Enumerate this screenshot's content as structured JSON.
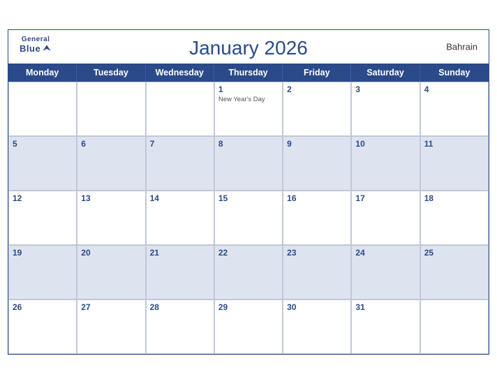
{
  "header": {
    "logo": {
      "general": "General",
      "blue": "Blue",
      "bird_unicode": "▲"
    },
    "title": "January 2026",
    "country": "Bahrain"
  },
  "days": [
    "Monday",
    "Tuesday",
    "Wednesday",
    "Thursday",
    "Friday",
    "Saturday",
    "Sunday"
  ],
  "weeks": [
    {
      "blue": false,
      "cells": [
        {
          "num": "",
          "holiday": ""
        },
        {
          "num": "",
          "holiday": ""
        },
        {
          "num": "",
          "holiday": ""
        },
        {
          "num": "1",
          "holiday": "New Year's Day"
        },
        {
          "num": "2",
          "holiday": ""
        },
        {
          "num": "3",
          "holiday": ""
        },
        {
          "num": "4",
          "holiday": ""
        }
      ]
    },
    {
      "blue": true,
      "cells": [
        {
          "num": "5",
          "holiday": ""
        },
        {
          "num": "6",
          "holiday": ""
        },
        {
          "num": "7",
          "holiday": ""
        },
        {
          "num": "8",
          "holiday": ""
        },
        {
          "num": "9",
          "holiday": ""
        },
        {
          "num": "10",
          "holiday": ""
        },
        {
          "num": "11",
          "holiday": ""
        }
      ]
    },
    {
      "blue": false,
      "cells": [
        {
          "num": "12",
          "holiday": ""
        },
        {
          "num": "13",
          "holiday": ""
        },
        {
          "num": "14",
          "holiday": ""
        },
        {
          "num": "15",
          "holiday": ""
        },
        {
          "num": "16",
          "holiday": ""
        },
        {
          "num": "17",
          "holiday": ""
        },
        {
          "num": "18",
          "holiday": ""
        }
      ]
    },
    {
      "blue": true,
      "cells": [
        {
          "num": "19",
          "holiday": ""
        },
        {
          "num": "20",
          "holiday": ""
        },
        {
          "num": "21",
          "holiday": ""
        },
        {
          "num": "22",
          "holiday": ""
        },
        {
          "num": "23",
          "holiday": ""
        },
        {
          "num": "24",
          "holiday": ""
        },
        {
          "num": "25",
          "holiday": ""
        }
      ]
    },
    {
      "blue": false,
      "cells": [
        {
          "num": "26",
          "holiday": ""
        },
        {
          "num": "27",
          "holiday": ""
        },
        {
          "num": "28",
          "holiday": ""
        },
        {
          "num": "29",
          "holiday": ""
        },
        {
          "num": "30",
          "holiday": ""
        },
        {
          "num": "31",
          "holiday": ""
        },
        {
          "num": "",
          "holiday": ""
        }
      ]
    }
  ],
  "colors": {
    "primary_blue": "#2a4a8a",
    "light_blue_row": "#dde4f0",
    "border": "#c0c8d8"
  }
}
